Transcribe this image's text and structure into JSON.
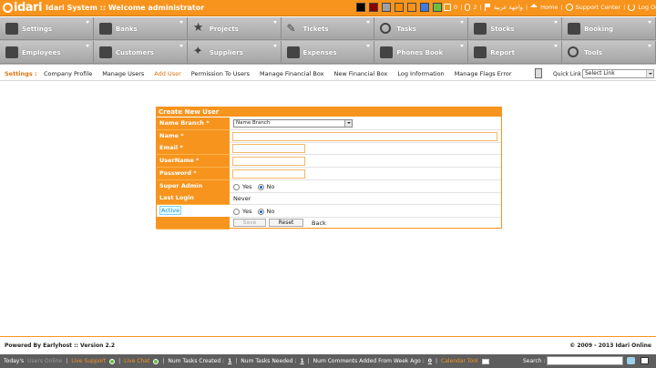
{
  "app": {
    "logo_text": "idari",
    "title": "Idari System :: Welcome administrator"
  },
  "theme": {
    "accent": "#f7941d",
    "menu_bg": "#b4b4b4",
    "swatches": [
      "#000000",
      "#8b0000",
      "#a0a0a0",
      "#ff8c00",
      "#f7941d",
      "#3b7ddd",
      "#6bbf3f"
    ]
  },
  "topbar": {
    "mail_count": "0",
    "attach_count": "2",
    "arabic_label": "واجهة عربية",
    "home_label": "Home",
    "support_label": "Support Center",
    "logout_label": "Log Out"
  },
  "menu": {
    "row1": [
      {
        "label": "Settings",
        "icon": "wrench-icon"
      },
      {
        "label": "Banks",
        "icon": "bank-icon"
      },
      {
        "label": "Projects",
        "icon": "star-icon"
      },
      {
        "label": "Tickets",
        "icon": "ticket-icon"
      },
      {
        "label": "Tasks",
        "icon": "tasks-icon"
      },
      {
        "label": "Stocks",
        "icon": "stocks-icon"
      },
      {
        "label": "Booking",
        "icon": "booking-icon"
      }
    ],
    "row2": [
      {
        "label": "Employees",
        "icon": "employees-icon"
      },
      {
        "label": "Customers",
        "icon": "customers-icon"
      },
      {
        "label": "Suppliers",
        "icon": "suppliers-icon"
      },
      {
        "label": "Expenses",
        "icon": "briefcase-icon"
      },
      {
        "label": "Phones Book",
        "icon": "phone-icon"
      },
      {
        "label": "Report",
        "icon": "report-icon"
      },
      {
        "label": "Tools",
        "icon": "gear-icon"
      }
    ]
  },
  "subnav": {
    "section_label": "Settings :",
    "links": [
      "Company Profile",
      "Manage Users",
      "Add User",
      "Permission To Users",
      "Manage Financial Box",
      "New Financial Box",
      "Log Information",
      "Manage Flags Error"
    ],
    "active_index": 2,
    "quick_link_label": "Quick Link",
    "quick_link_value": "Select Link"
  },
  "form": {
    "title": "Create New User",
    "name_branch_label": "Name Branch *",
    "name_branch_value": "Name Branch",
    "name_label": "Name *",
    "name_value": "",
    "email_label": "Email *",
    "email_value": "",
    "username_label": "UserName *",
    "username_value": "",
    "password_label": "Password *",
    "password_value": "",
    "super_admin_label": "Super Admin",
    "super_admin_value": "No",
    "last_login_label": "Last Login",
    "last_login_value": "Never",
    "active_label": "Active",
    "active_value": "No",
    "yes_label": "Yes",
    "no_label": "No",
    "save_label": "Save",
    "reset_label": "Reset",
    "back_label": "Back"
  },
  "footer": {
    "left": "Powered By Earlyhost :: Version 2.2",
    "right": "© 2009 - 2013 Idari Online"
  },
  "statusbar": {
    "user_label": "Today's",
    "status_text": "Users Online",
    "support_label": "Live Support",
    "chat_label": "Live Chat",
    "num_tasks_created_label": "Num Tasks Created :",
    "num_tasks_created": "1",
    "num_tasks_needed_label": "Num Tasks Needed :",
    "num_tasks_needed": "1",
    "num_comments_label": "Num Comments Added From Week Ago :",
    "num_comments": "0",
    "calendar_label": "Calendar Tool",
    "search_label": "Search :",
    "search_value": ""
  }
}
